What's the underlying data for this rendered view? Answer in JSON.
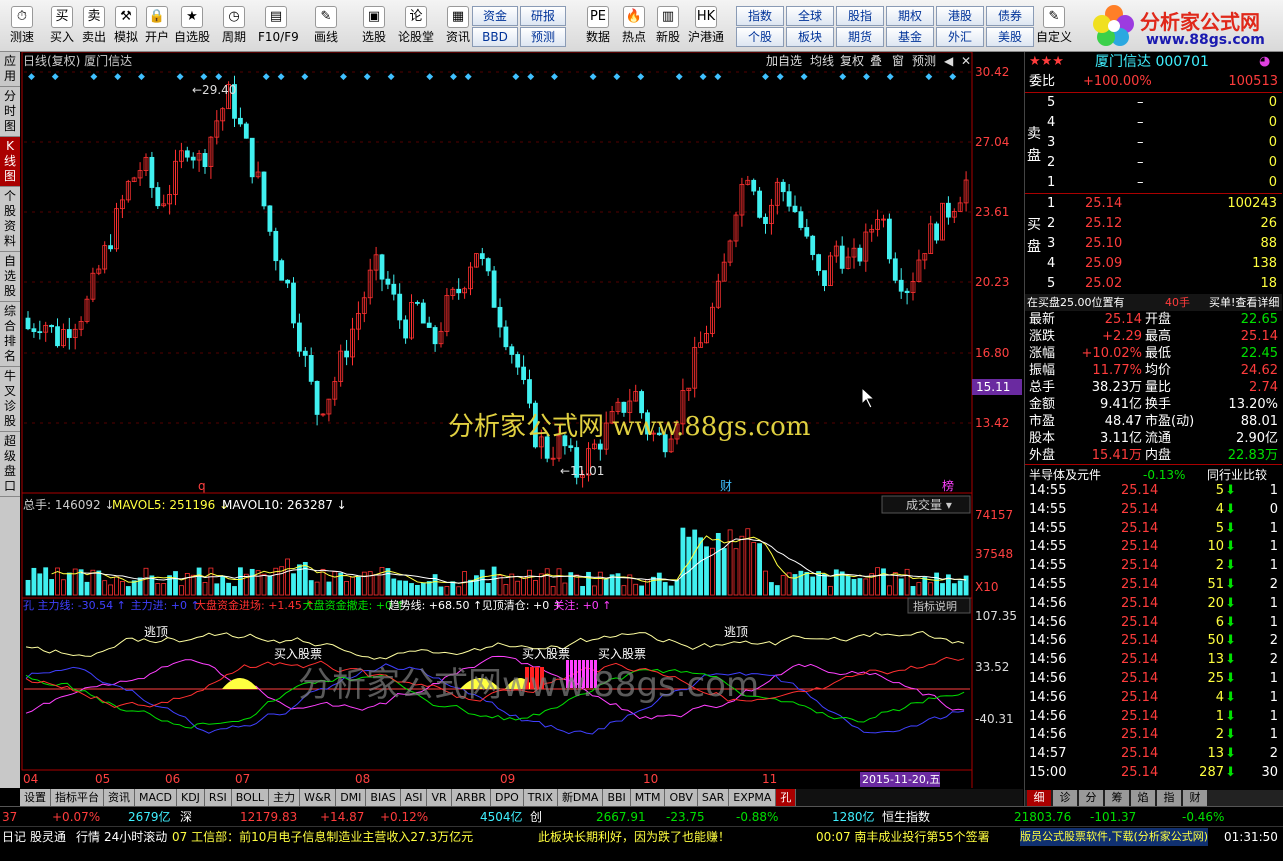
{
  "toolbar": {
    "buttons": [
      {
        "label": "测速",
        "icon": "speed-icon",
        "glyph": "⏱"
      },
      {
        "label": "买入",
        "icon": "buy-icon",
        "glyph": "买"
      },
      {
        "label": "卖出",
        "icon": "sell-icon",
        "glyph": "卖"
      },
      {
        "label": "模拟",
        "icon": "hammer-icon",
        "glyph": "⚒"
      },
      {
        "label": "开户",
        "icon": "lock-icon",
        "glyph": "🔒"
      },
      {
        "label": "自选股",
        "icon": "star-icon",
        "glyph": "★"
      },
      {
        "label": "周期",
        "icon": "clock-icon",
        "glyph": "◷"
      },
      {
        "label": "F10/F9",
        "icon": "document-icon",
        "glyph": "▤"
      },
      {
        "label": "画线",
        "icon": "pen-icon",
        "glyph": "✎"
      },
      {
        "label": "选股",
        "icon": "screen-icon",
        "glyph": "▣"
      },
      {
        "label": "论股堂",
        "icon": "chat-icon",
        "glyph": "论"
      },
      {
        "label": "资讯",
        "icon": "news-icon",
        "glyph": "▦"
      },
      {
        "label": "数据",
        "icon": "pe-icon",
        "glyph": "PE"
      },
      {
        "label": "热点",
        "icon": "fire-icon",
        "glyph": "🔥"
      },
      {
        "label": "新股",
        "icon": "ipo-icon",
        "glyph": "▥"
      },
      {
        "label": "沪港通",
        "icon": "hk-connect-icon",
        "glyph": "HK"
      },
      {
        "label": "自定义",
        "icon": "custom-icon",
        "glyph": "✎"
      }
    ],
    "smallbuttons": [
      "资金",
      "研报",
      "BBD",
      "预测",
      "指数",
      "全球",
      "股指",
      "期权",
      "港股",
      "债券",
      "个股",
      "板块",
      "期货",
      "基金",
      "外汇",
      "美股"
    ]
  },
  "logo": {
    "title": "分析家公式网",
    "url": "www.88gs.com"
  },
  "lefttabs": [
    "应用",
    "分时图",
    "K线图",
    "个股资料",
    "自选股",
    "综合排名",
    "牛叉诊股",
    "超级盘口"
  ],
  "chart": {
    "header": "日线(复权)  厦门信达",
    "buttons": [
      "加自选",
      "均线",
      "复权",
      "叠",
      "窗",
      "预测"
    ],
    "price_labels": [
      "30.42",
      "27.04",
      "23.61",
      "20.23",
      "16.80",
      "13.42"
    ],
    "current_price_tag": "15.11",
    "high_label": "29.40",
    "low_label": "11.01",
    "watermark": "分析家公式网  www.88gs.com",
    "watermark2": "分析家公式网www.88gs.com",
    "markers": [
      "q",
      "财",
      "榜"
    ],
    "vol_header": {
      "a": "总手: 146092",
      "b": "MAVOL5: 251196",
      "c": "MAVOL10: 263287"
    },
    "vol_dropdown": "成交量",
    "vol_labels": [
      "74157",
      "37548",
      "X10"
    ],
    "ind_header": [
      {
        "t": "孔 主力线: -30.54",
        "c": "#4040ff"
      },
      {
        "t": "主力进: +0",
        "c": "#4040ff"
      },
      {
        "t": "大盘资金进场: +1.45",
        "c": "#ff3030"
      },
      {
        "t": "大盘资金撤走: +0",
        "c": "#00e000"
      },
      {
        "t": "趋势线: +68.50",
        "c": "#ffffff"
      },
      {
        "t": "见顶清仓: +0",
        "c": "#ffffff"
      },
      {
        "t": "关注: +0",
        "c": "#ff40ff"
      }
    ],
    "ind_help": "指标说明",
    "ind_labels": [
      "107.35",
      "33.52",
      "-40.31"
    ],
    "ind_texts": [
      "逃顶",
      "逃顶",
      "买入股票",
      "买入股票",
      "买入股票"
    ],
    "xaxis": [
      "04",
      "05",
      "06",
      "07",
      "08",
      "09",
      "10",
      "11"
    ],
    "date_tag": "2015-11-20,五"
  },
  "bottomtabs": [
    "设置",
    "指标平台",
    "资讯",
    "MACD",
    "KDJ",
    "RSI",
    "BOLL",
    "主力",
    "W&R",
    "DMI",
    "BIAS",
    "ASI",
    "VR",
    "ARBR",
    "DPO",
    "TRIX",
    "新DMA",
    "BBI",
    "MTM",
    "OBV",
    "SAR",
    "EXPMA",
    "孔"
  ],
  "quote": {
    "name": "厦门信达",
    "code": "000701",
    "weibi_label": "委比",
    "weibi": "+100.00%",
    "weicha": "100513",
    "sell_label": "卖盘",
    "sell": [
      {
        "n": "5",
        "p": "–",
        "v": "0"
      },
      {
        "n": "4",
        "p": "–",
        "v": "0"
      },
      {
        "n": "3",
        "p": "–",
        "v": "0"
      },
      {
        "n": "2",
        "p": "–",
        "v": "0"
      },
      {
        "n": "1",
        "p": "–",
        "v": "0"
      }
    ],
    "buy_label": "买盘",
    "buy": [
      {
        "n": "1",
        "p": "25.14",
        "v": "100243"
      },
      {
        "n": "2",
        "p": "25.12",
        "v": "26"
      },
      {
        "n": "3",
        "p": "25.10",
        "v": "88"
      },
      {
        "n": "4",
        "p": "25.09",
        "v": "138"
      },
      {
        "n": "5",
        "p": "25.02",
        "v": "18"
      }
    ],
    "order_note": "在买盘25.00位置有",
    "order_qty": "40手",
    "order_link": "买单!查看详细",
    "stats": [
      [
        "最新",
        "25.14",
        "red",
        "开盘",
        "22.65",
        "green"
      ],
      [
        "涨跌",
        "+2.29",
        "red",
        "最高",
        "25.14",
        "red"
      ],
      [
        "涨幅",
        "+10.02%",
        "red",
        "最低",
        "22.45",
        "green"
      ],
      [
        "振幅",
        "11.77%",
        "red",
        "均价",
        "24.62",
        "red"
      ],
      [
        "总手",
        "38.23万",
        "white",
        "量比",
        "2.74",
        "red"
      ],
      [
        "金额",
        "9.41亿",
        "white",
        "换手",
        "13.20%",
        "white"
      ],
      [
        "市盈",
        "48.47",
        "white",
        "市盈(动)",
        "88.01",
        "white"
      ],
      [
        "股本",
        "3.11亿",
        "white",
        "流通",
        "2.90亿",
        "white"
      ],
      [
        "外盘",
        "15.41万",
        "red",
        "内盘",
        "22.83万",
        "green"
      ]
    ],
    "sector": "半导体及元件",
    "sector_chg": "-0.13%",
    "sector_cmp": "同行业比较",
    "ticks": [
      [
        "14:55",
        "25.14",
        "5",
        "1"
      ],
      [
        "14:55",
        "25.14",
        "4",
        "0"
      ],
      [
        "14:55",
        "25.14",
        "5",
        "1"
      ],
      [
        "14:55",
        "25.14",
        "10",
        "1"
      ],
      [
        "14:55",
        "25.14",
        "2",
        "1"
      ],
      [
        "14:55",
        "25.14",
        "51",
        "2"
      ],
      [
        "14:56",
        "25.14",
        "20",
        "1"
      ],
      [
        "14:56",
        "25.14",
        "6",
        "1"
      ],
      [
        "14:56",
        "25.14",
        "50",
        "2"
      ],
      [
        "14:56",
        "25.14",
        "13",
        "2"
      ],
      [
        "14:56",
        "25.14",
        "25",
        "1"
      ],
      [
        "14:56",
        "25.14",
        "4",
        "1"
      ],
      [
        "14:56",
        "25.14",
        "1",
        "1"
      ],
      [
        "14:56",
        "25.14",
        "2",
        "1"
      ],
      [
        "14:57",
        "25.14",
        "13",
        "2"
      ],
      [
        "15:00",
        "25.14",
        "287",
        "30"
      ]
    ],
    "tabs": [
      "细",
      "诊",
      "分",
      "筹",
      "焰",
      "指",
      "财"
    ]
  },
  "status": {
    "s1": "37",
    "s2": "+0.07%",
    "s3": "2679亿",
    "s4": "深",
    "s5": "12179.83",
    "s6": "+14.87",
    "s7": "+0.12%",
    "s8": "4504亿",
    "s9": "创",
    "s10": "2667.91",
    "s11": "-23.75",
    "s12": "-0.88%",
    "s13": "1280亿",
    "s14": "恒生指数",
    "s15": "21803.76",
    "s16": "-101.37",
    "s17": "-0.46%"
  },
  "ticker": {
    "t1": "日记",
    "t2": "股灵通",
    "t3": "行情",
    "t4": "24小时滚动",
    "t5": "07 工信部：前10月电子信息制造业主营收入27.3万亿元",
    "t6": "此板块长期利好，因为跌了也能赚！",
    "t7": "00:07 南丰成业投行第55个签署",
    "t8": "版员公式股票软件,下载(分析家公式网)",
    "t9": "01:31:50"
  }
}
